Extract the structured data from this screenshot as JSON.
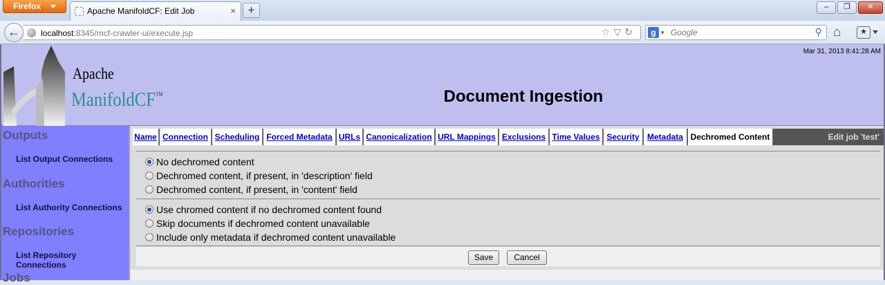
{
  "browser": {
    "menu_label": "Firefox",
    "tab_title": "Apache ManifoldCF: Edit Job",
    "tab_close": "×",
    "new_tab": "+",
    "url_host": "localhost",
    "url_rest": ":8345/mcf-crawler-ui/execute.jsp",
    "search_engine": "g",
    "search_placeholder": "Google",
    "window_buttons": {
      "minimize": "–",
      "restore": "❐",
      "close": "✕"
    }
  },
  "header": {
    "timestamp": "Mar 31, 2013 8:41:28 AM",
    "logo_line1": "Apache",
    "logo_line2": "ManifoldCF",
    "logo_tm": "™",
    "title": "Document Ingestion"
  },
  "sidebar": {
    "sections": [
      {
        "heading": "Outputs",
        "link": "List Output Connections"
      },
      {
        "heading": "Authorities",
        "link": "List Authority Connections"
      },
      {
        "heading": "Repositories",
        "link": "List Repository Connections"
      },
      {
        "heading": "Jobs",
        "link": ""
      }
    ]
  },
  "tabs": [
    {
      "label": "Name"
    },
    {
      "label": "Connection"
    },
    {
      "label": "Scheduling"
    },
    {
      "label": "Forced Metadata"
    },
    {
      "label": "URLs"
    },
    {
      "label": "Canonicalization"
    },
    {
      "label": "URL Mappings"
    },
    {
      "label": "Exclusions"
    },
    {
      "label": "Time Values"
    },
    {
      "label": "Security"
    },
    {
      "label": "Metadata"
    },
    {
      "label": "Dechromed Content",
      "active": true
    }
  ],
  "edit_label": "Edit job 'test'",
  "dechromed_options": [
    {
      "label": "No dechromed content",
      "selected": true
    },
    {
      "label": "Dechromed content, if present, in 'description' field",
      "selected": false
    },
    {
      "label": "Dechromed content, if present, in 'content' field",
      "selected": false
    }
  ],
  "chromed_options": [
    {
      "label": "Use chromed content if no dechromed content found",
      "selected": true
    },
    {
      "label": "Skip documents if dechromed content unavailable",
      "selected": false
    },
    {
      "label": "Include only metadata if dechromed content unavailable",
      "selected": false
    }
  ],
  "buttons": {
    "save": "Save",
    "cancel": "Cancel"
  },
  "colors": {
    "header_bg": "#bfbfef",
    "sidebar_bg": "#7f7fff",
    "tab_link": "#0000c8",
    "logo_teal": "#2f8f8a"
  }
}
